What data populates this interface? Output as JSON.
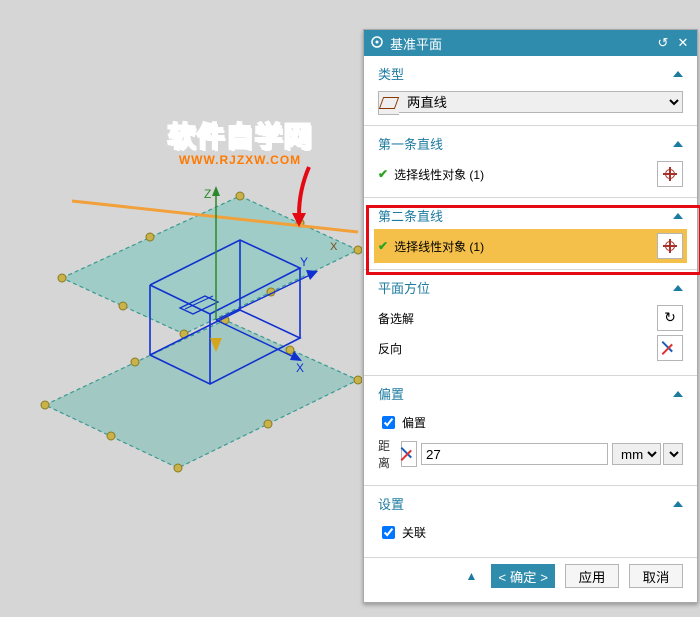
{
  "logo": {
    "line1": "软件自学网",
    "line2": "WWW.RJZXW.COM"
  },
  "panel": {
    "title": "基准平面",
    "type_section": {
      "label": "类型",
      "value": "两直线"
    },
    "line1_section": {
      "label": "第一条直线",
      "pick_prefix": "选择线性对象 (",
      "count": 1,
      "pick_suffix": ")"
    },
    "line2_section": {
      "label": "第二条直线",
      "pick_prefix": "选择线性对象 (",
      "count": 1,
      "pick_suffix": ")"
    },
    "orient_section": {
      "label": "平面方位",
      "alternate": "备选解",
      "reverse": "反向"
    },
    "offset_section": {
      "label": "偏置",
      "checkbox": "偏置",
      "checked": true,
      "distance_label": "距离",
      "distance_value": "27",
      "unit": "mm"
    },
    "settings_section": {
      "label": "设置",
      "assoc_label": "关联",
      "assoc_checked": true
    },
    "buttons": {
      "ok": "< 确定 >",
      "apply": "应用",
      "cancel": "取消"
    }
  },
  "axes": {
    "x": "X",
    "y": "Y",
    "z": "Z"
  }
}
